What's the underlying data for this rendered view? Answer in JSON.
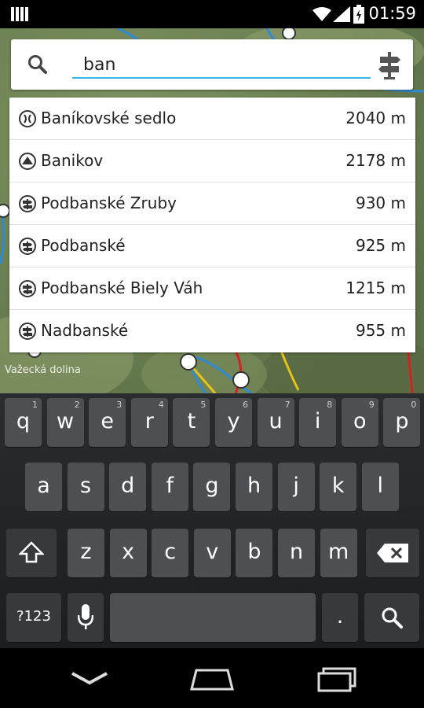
{
  "status_bar": {
    "time": "01:59",
    "icons": [
      "notification-icon",
      "wifi-icon",
      "signal-icon",
      "battery-icon"
    ]
  },
  "search": {
    "query": "ban",
    "icon": "search-icon",
    "action_icon": "signpost-icon"
  },
  "results": [
    {
      "icon": "saddle-icon",
      "name": "Baníkovské sedlo",
      "altitude": "2040 m"
    },
    {
      "icon": "peak-icon",
      "name": "Banikov",
      "altitude": "2178 m"
    },
    {
      "icon": "signpost-icon",
      "name": "Podbanské Zruby",
      "altitude": "930 m"
    },
    {
      "icon": "signpost-icon",
      "name": "Podbanské",
      "altitude": "925 m"
    },
    {
      "icon": "signpost-icon",
      "name": "Podbanské Biely Váh",
      "altitude": "1215 m"
    },
    {
      "icon": "signpost-icon",
      "name": "Nadbanské",
      "altitude": "955 m"
    }
  ],
  "map": {
    "label": "Važecká dolina"
  },
  "keyboard": {
    "row1": [
      {
        "key": "q",
        "hint": "1"
      },
      {
        "key": "w",
        "hint": "2"
      },
      {
        "key": "e",
        "hint": "3"
      },
      {
        "key": "r",
        "hint": "4"
      },
      {
        "key": "t",
        "hint": "5"
      },
      {
        "key": "y",
        "hint": "6"
      },
      {
        "key": "u",
        "hint": "7"
      },
      {
        "key": "i",
        "hint": "8"
      },
      {
        "key": "o",
        "hint": "9"
      },
      {
        "key": "p",
        "hint": "0"
      }
    ],
    "row2": [
      "a",
      "s",
      "d",
      "f",
      "g",
      "h",
      "j",
      "k",
      "l"
    ],
    "row3": [
      "z",
      "x",
      "c",
      "v",
      "b",
      "n",
      "m"
    ],
    "symbols_label": "?123",
    "period_label": "."
  },
  "nav": {
    "buttons": [
      "back-icon",
      "home-icon",
      "recents-icon"
    ]
  }
}
